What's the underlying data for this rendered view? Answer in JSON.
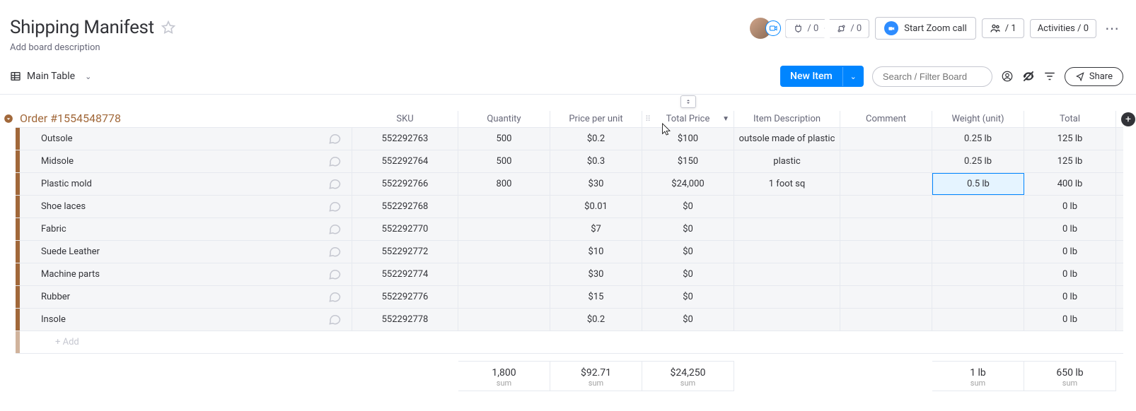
{
  "header": {
    "title": "Shipping Manifest",
    "description": "Add board description",
    "integrations_count": "/ 0",
    "automations_count": "/ 0",
    "zoom_label": "Start Zoom call",
    "people_count": "/ 1",
    "activities_label": "Activities / 0"
  },
  "subheader": {
    "view_name": "Main Table",
    "new_item_label": "New Item",
    "search_placeholder": "Search / Filter Board",
    "share_label": "Share"
  },
  "group": {
    "title": "Order #1554548778",
    "color": "#a1683a"
  },
  "columns": {
    "sku": "SKU",
    "quantity": "Quantity",
    "price_per_unit": "Price per unit",
    "total_price": "Total Price",
    "item_description": "Item Description",
    "comment": "Comment",
    "weight_unit": "Weight (unit)",
    "total": "Total"
  },
  "rows": [
    {
      "name": "Outsole",
      "sku": "552292763",
      "qty": "500",
      "ppu": "$0.2",
      "tprice": "$100",
      "desc": "outsole made of plastic",
      "comment": "",
      "wgt": "0.25 lb",
      "total": "125 lb"
    },
    {
      "name": "Midsole",
      "sku": "552292764",
      "qty": "500",
      "ppu": "$0.3",
      "tprice": "$150",
      "desc": "plastic",
      "comment": "",
      "wgt": "0.25 lb",
      "total": "125 lb"
    },
    {
      "name": "Plastic mold",
      "sku": "552292766",
      "qty": "800",
      "ppu": "$30",
      "tprice": "$24,000",
      "desc": "1 foot sq",
      "comment": "",
      "wgt": "0.5 lb",
      "total": "400 lb",
      "highlight_wgt": true
    },
    {
      "name": "Shoe laces",
      "sku": "552292768",
      "qty": "",
      "ppu": "$0.01",
      "tprice": "$0",
      "desc": "",
      "comment": "",
      "wgt": "",
      "total": "0 lb"
    },
    {
      "name": "Fabric",
      "sku": "552292770",
      "qty": "",
      "ppu": "$7",
      "tprice": "$0",
      "desc": "",
      "comment": "",
      "wgt": "",
      "total": "0 lb"
    },
    {
      "name": "Suede Leather",
      "sku": "552292772",
      "qty": "",
      "ppu": "$10",
      "tprice": "$0",
      "desc": "",
      "comment": "",
      "wgt": "",
      "total": "0 lb"
    },
    {
      "name": "Machine parts",
      "sku": "552292774",
      "qty": "",
      "ppu": "$30",
      "tprice": "$0",
      "desc": "",
      "comment": "",
      "wgt": "",
      "total": "0 lb"
    },
    {
      "name": "Rubber",
      "sku": "552292776",
      "qty": "",
      "ppu": "$15",
      "tprice": "$0",
      "desc": "",
      "comment": "",
      "wgt": "",
      "total": "0 lb"
    },
    {
      "name": "Insole",
      "sku": "552292778",
      "qty": "",
      "ppu": "$0.2",
      "tprice": "$0",
      "desc": "",
      "comment": "",
      "wgt": "",
      "total": "0 lb"
    }
  ],
  "add_row_label": "+ Add",
  "footer": {
    "qty_sum": "1,800",
    "ppu_sum": "$92.71",
    "tprice_sum": "$24,250",
    "wgt_sum": "1 lb",
    "total_sum": "650 lb",
    "sum_label": "sum"
  }
}
